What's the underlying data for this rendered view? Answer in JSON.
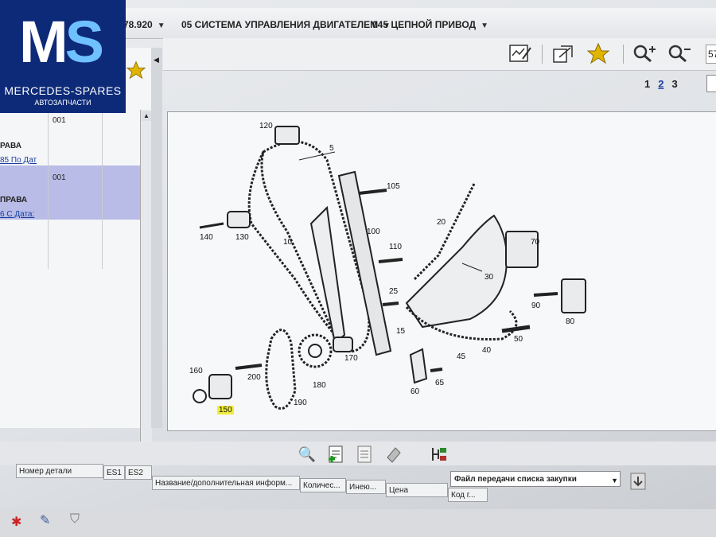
{
  "logo": {
    "mark_m": "M",
    "mark_s": "S",
    "name": "MERCEDES-SPARES",
    "sub": "АВТОЗАПЧАСТИ"
  },
  "breadcrumb": {
    "model": "78.920",
    "group": "05 СИСТЕМА УПРАВЛЕНИЯ ДВИГАТЕЛЕМ",
    "subgroup": "045 ЦЕПНОЙ ПРИВОД"
  },
  "toolbar": {
    "icons": [
      "edit-note-icon",
      "copy-window-icon",
      "star-icon",
      "zoom-in-icon",
      "zoom-out-icon"
    ],
    "zoom_value": "57"
  },
  "pager": {
    "pages": [
      "1",
      "2",
      "3"
    ],
    "current": "2"
  },
  "left_panel": {
    "rows": [
      {
        "code": "001",
        "title": "РАВА",
        "link": "85 По Дат"
      },
      {
        "code": "001",
        "title": "ПРАВА",
        "link": "6 С Дата:"
      }
    ]
  },
  "diagram": {
    "callouts": [
      "120",
      "5",
      "105",
      "100",
      "140",
      "130",
      "10",
      "20",
      "70",
      "110",
      "30",
      "25",
      "90",
      "80",
      "15",
      "50",
      "170",
      "40",
      "45",
      "160",
      "200",
      "180",
      "60",
      "65",
      "150",
      "190"
    ],
    "highlighted": "150"
  },
  "bottom": {
    "purchase_file": "Файл передачи списка закупки",
    "columns": {
      "part_number": "Номер детали",
      "es1": "ES1",
      "es2": "ES2",
      "name": "Название/дополнительная информ...",
      "qty": "Количес...",
      "avail": "Инею...",
      "price": "Цена",
      "code": "Код г..."
    }
  },
  "colors": {
    "logo_bg": "#0d2a78",
    "logo_accent": "#6fc0ff",
    "selected_row": "#b8bce6",
    "highlight": "#f1ec3a"
  }
}
